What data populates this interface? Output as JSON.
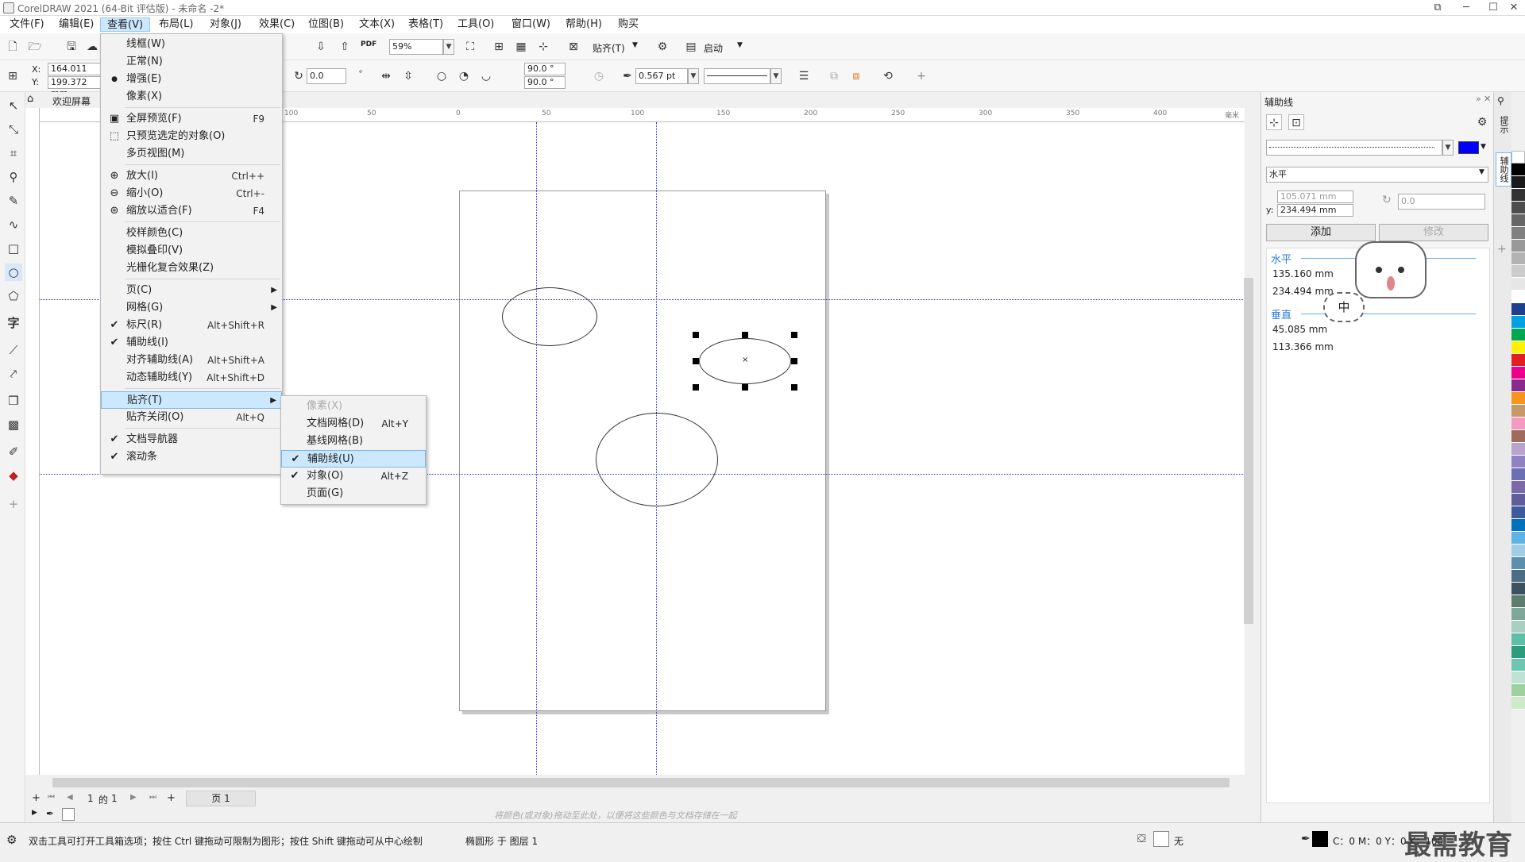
{
  "title": "CorelDRAW 2021 (64-Bit 评估版) - 未命名 -2*",
  "menus": [
    "文件(F)",
    "编辑(E)",
    "查看(V)",
    "布局(L)",
    "对象(J)",
    "效果(C)",
    "位图(B)",
    "文本(X)",
    "表格(T)",
    "工具(O)",
    "窗口(W)",
    "帮助(H)",
    "购买"
  ],
  "toolbar": {
    "zoom": "59%",
    "snap_label": "贴齐(T)",
    "launch_label": "启动",
    "pdf": "PDF"
  },
  "props": {
    "x": "164.011 mm",
    "y": "199.372 mm",
    "x_label": "X:",
    "y_label": "Y:",
    "rotate": "0.0",
    "angle1": "90.0 °",
    "angle2": "90.0 °",
    "outline": "0.567 pt"
  },
  "tab": {
    "welcome": "欢迎屏幕"
  },
  "view_menu": [
    {
      "label": "线框(W)",
      "sc": "",
      "icon": ""
    },
    {
      "label": "正常(N)",
      "sc": "",
      "icon": ""
    },
    {
      "label": "增强(E)",
      "sc": "",
      "icon": "●"
    },
    {
      "label": "像素(X)",
      "sc": "",
      "icon": ""
    },
    {
      "label": "全屏预览(F)",
      "sc": "F9",
      "icon": "▣"
    },
    {
      "label": "只预览选定的对象(O)",
      "sc": "",
      "icon": "⬚"
    },
    {
      "label": "多页视图(M)",
      "sc": "",
      "icon": ""
    },
    {
      "label": "放大(I)",
      "sc": "Ctrl++",
      "icon": "⊕"
    },
    {
      "label": "缩小(O)",
      "sc": "Ctrl+-",
      "icon": "⊖"
    },
    {
      "label": "缩放以适合(F)",
      "sc": "F4",
      "icon": "⊛"
    },
    {
      "label": "校样颜色(C)",
      "sc": "",
      "icon": ""
    },
    {
      "label": "模拟叠印(V)",
      "sc": "",
      "icon": ""
    },
    {
      "label": "光栅化复合效果(Z)",
      "sc": "",
      "icon": ""
    },
    {
      "label": "页(C)",
      "sc": "",
      "icon": ""
    },
    {
      "label": "网格(G)",
      "sc": "",
      "icon": ""
    },
    {
      "label": "标尺(R)",
      "sc": "Alt+Shift+R",
      "icon": "✔"
    },
    {
      "label": "辅助线(I)",
      "sc": "",
      "icon": "✔"
    },
    {
      "label": "对齐辅助线(A)",
      "sc": "Alt+Shift+A",
      "icon": ""
    },
    {
      "label": "动态辅助线(Y)",
      "sc": "Alt+Shift+D",
      "icon": ""
    },
    {
      "label": "贴齐(T)",
      "sc": "",
      "icon": ""
    },
    {
      "label": "贴齐关闭(O)",
      "sc": "Alt+Q",
      "icon": ""
    },
    {
      "label": "文档导航器",
      "sc": "",
      "icon": "✔"
    },
    {
      "label": "滚动条",
      "sc": "",
      "icon": "✔"
    }
  ],
  "snap_menu": [
    {
      "label": "像素(X)",
      "sc": "",
      "icon": "",
      "disabled": true
    },
    {
      "label": "文档网格(D)",
      "sc": "Alt+Y",
      "icon": ""
    },
    {
      "label": "基线网格(B)",
      "sc": "",
      "icon": ""
    },
    {
      "label": "辅助线(U)",
      "sc": "",
      "icon": "✔"
    },
    {
      "label": "对象(O)",
      "sc": "Alt+Z",
      "icon": "✔"
    },
    {
      "label": "页面(G)",
      "sc": "",
      "icon": ""
    }
  ],
  "panel": {
    "title": "辅助线",
    "orientation": "水平",
    "x": "105.071 mm",
    "y": "234.494 mm",
    "y_label": "y:",
    "angle": "0.0",
    "add": "添加",
    "modify": "修改",
    "h_label": "水平",
    "h_values": [
      "135.160 mm",
      "234.494 mm"
    ],
    "v_label": "垂直",
    "v_values": [
      "45.085 mm",
      "113.366 mm"
    ],
    "side_tab1": "提示",
    "side_tab2": "辅助线",
    "badge": "中"
  },
  "pagebar": {
    "current": "1",
    "of": "的",
    "total": "1",
    "page_tab": "页 1"
  },
  "colorbar_hint": "将颜色(或对象)拖动至此处，以便将这些颜色与文档存储在一起",
  "status": {
    "hint": "双击工具可打开工具箱选项；按住 Ctrl 键拖动可限制为图形；按住 Shift 键拖动可从中心绘制",
    "object": "椭圆形 于 图层 1",
    "fill": "无",
    "cmyk": "C：0 M：0 Y：0 K：100"
  },
  "watermark": "最需教育",
  "ruler_h": [
    "100",
    "50",
    "0",
    "50",
    "100",
    "150",
    "200",
    "250",
    "300",
    "350",
    "400",
    "毫米"
  ],
  "colors": {
    "guide": "#3333dd",
    "accent": "#0000ff",
    "menu_sel": "#cce8ff"
  }
}
